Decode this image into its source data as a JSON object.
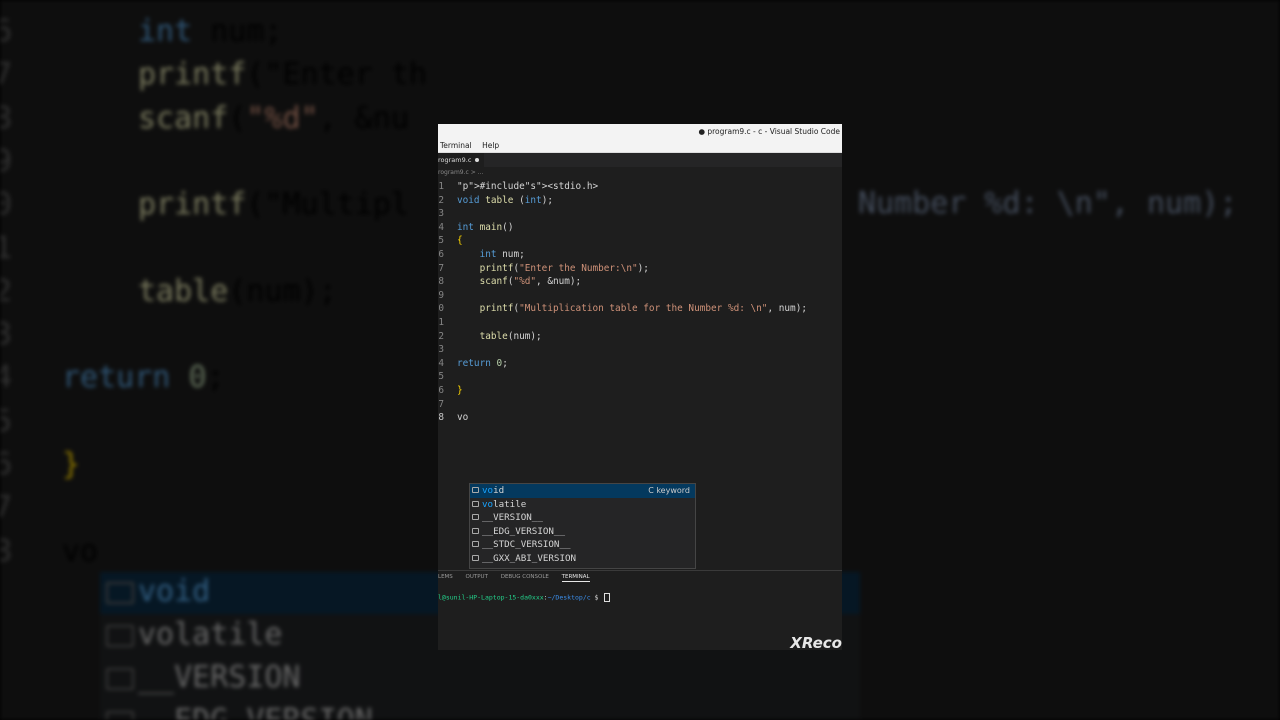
{
  "window": {
    "title": "● program9.c - c - Visual Studio Code",
    "menu": [
      "Terminal",
      "Help"
    ],
    "tab_label": "rogram9.c",
    "breadcrumb": "rogram9.c > ..."
  },
  "editor": {
    "lines": [
      {
        "num": "1",
        "text": "#include<stdio.h>"
      },
      {
        "num": "2",
        "text": "void table (int);"
      },
      {
        "num": "3",
        "text": ""
      },
      {
        "num": "4",
        "text": "int main()"
      },
      {
        "num": "5",
        "text": "{"
      },
      {
        "num": "6",
        "text": "    int num;"
      },
      {
        "num": "7",
        "text": "    printf(\"Enter the Number:\\n\");"
      },
      {
        "num": "8",
        "text": "    scanf(\"%d\", &num);"
      },
      {
        "num": "9",
        "text": ""
      },
      {
        "num": "0",
        "text": "    printf(\"Multiplication table for the Number %d: \\n\", num);"
      },
      {
        "num": "1",
        "text": ""
      },
      {
        "num": "2",
        "text": "    table(num);"
      },
      {
        "num": "3",
        "text": ""
      },
      {
        "num": "4",
        "text": "return 0;"
      },
      {
        "num": "5",
        "text": ""
      },
      {
        "num": "6",
        "text": "}"
      },
      {
        "num": "7",
        "text": ""
      },
      {
        "num": "8",
        "text": "vo"
      }
    ]
  },
  "suggestions": {
    "items": [
      {
        "label": "void",
        "detail": "C keyword",
        "selected": true
      },
      {
        "label": "volatile",
        "detail": ""
      },
      {
        "label": "__VERSION__",
        "detail": ""
      },
      {
        "label": "__EDG_VERSION__",
        "detail": ""
      },
      {
        "label": "__STDC_VERSION__",
        "detail": ""
      },
      {
        "label": "__GXX_ABI_VERSION",
        "detail": ""
      }
    ]
  },
  "panel": {
    "tabs": [
      "LEMS",
      "OUTPUT",
      "DEBUG CONSOLE",
      "TERMINAL"
    ],
    "active_tab": "TERMINAL",
    "prompt_user": "l@sunil-HP-Laptop-15-da0xxx",
    "prompt_sep": ":",
    "prompt_dir": "~/Desktop/c",
    "prompt_sym": " $ "
  },
  "watermark": "XReco",
  "background": {
    "lines": [
      {
        "num": "6",
        "text": "int num;"
      },
      {
        "num": "7",
        "text": "printf(\"Enter th"
      },
      {
        "num": "8",
        "text": "scanf(\"%d\", &nu"
      },
      {
        "num": "9",
        "text": ""
      },
      {
        "num": "0",
        "text": "printf(\"Multipl"
      },
      {
        "num": "1",
        "text": ""
      },
      {
        "num": "2",
        "text": "table(num);"
      },
      {
        "num": "3",
        "text": ""
      },
      {
        "num": "4",
        "text": "return 0;"
      },
      {
        "num": "5",
        "text": ""
      },
      {
        "num": "6",
        "text": "}"
      },
      {
        "num": "7",
        "text": ""
      },
      {
        "num": "8",
        "text": "vo"
      }
    ],
    "right_fragment": "Number %d: \\n\", num);",
    "suggest": [
      "void",
      "volatile",
      "__VERSION",
      "__EDG_VERSION"
    ]
  },
  "colors": {
    "keyword": "#569cd6",
    "function": "#dcdcaa",
    "string": "#ce9178",
    "preprocessor": "#c586c0",
    "selection": "#04395e",
    "match": "#18a3ff"
  }
}
